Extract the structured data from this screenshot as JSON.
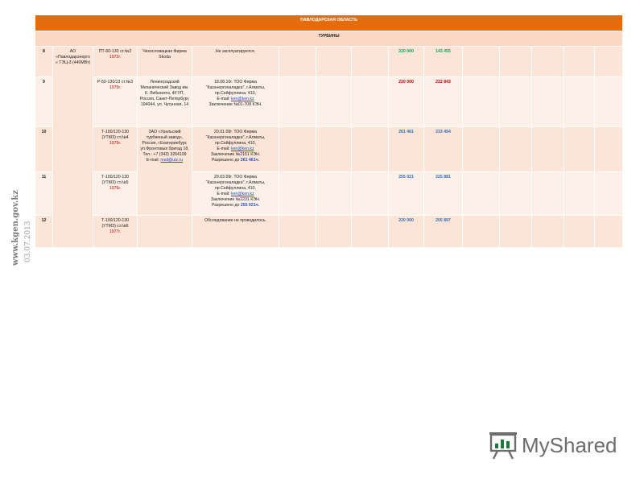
{
  "side": {
    "url": "www.kgen.gov.kz",
    "date": "03.07.2013"
  },
  "table": {
    "region": "ПАВЛОДАРСКАЯ ОБЛАСТЬ",
    "section": "ТУРБИНЫ",
    "owner": "АО «Павлодарэнерго» ТЭЦ-3 (440МВт)",
    "rows": [
      {
        "num": "8",
        "turbine": "ПТ-60-130 ст.№2",
        "year": "1972г.",
        "maker": "Чехословацкая Фирма Skoda",
        "status_lines": [
          "Не эксплуатируется."
        ],
        "email": "",
        "after_email": [],
        "val1": "220 000",
        "val2": "143 455"
      },
      {
        "num": "9",
        "turbine": "Р-50-130/13 ст.№3",
        "year": "1975г.",
        "maker": "Ленинградский Механический Завод им. К. Либкнехта, ФГУП, Россия, Санкт-Петербург, 194044, ул. Чугунная, 14",
        "status_lines": [
          "18.08.10г. ТОО Фирма \"Казэнергоналадка\", г.Алматы, пр.Сейфуллина, 410,"
        ],
        "email_label": "E-mail:",
        "email": "ken@ken.kz",
        "after_email": [
          "Заключение №01-708 КЭН."
        ],
        "val1": "220 000",
        "val2": "222 843"
      },
      {
        "num": "10",
        "turbine": "Т-100/120-130 (УТМЗ) ст.№4",
        "year": "1975г.",
        "maker": "ЗАО «Уральский турбинный завод», Россия, г.Екатеринбург, ул.Фронтовых бригад 18, Тел.: +7 (343) 3264109",
        "maker_email_label": "E-mail:",
        "maker_email": "mail@utz.ru",
        "status_lines": [
          "20.01.09г. ТОО Фирма \"Казэнергоналадка\", г.Алматы, пр.Сейфуллина, 410,"
        ],
        "email_label": "E-mail:",
        "email": "ken@ken.kz",
        "after_email": [
          "Заключение №2151 КЭН."
        ],
        "allowed_label": "Разрешено до",
        "allowed_value": "261 461ч.",
        "val1": "261 461",
        "val2": "233 454"
      },
      {
        "num": "11",
        "turbine": "Т-100/120-130 (УТМЗ) ст.№5",
        "year": "1976г.",
        "status_lines": [
          "29.03.09г. ТОО Фирма \"Казэнергоналадка\", г.Алматы, пр.Сейфуллина, 410,"
        ],
        "email_label": "E-mail:",
        "email": "ken@ken.kz",
        "after_email": [
          "Заключение №2231 КЭН."
        ],
        "allowed_label": "Разрешено до",
        "allowed_value": "255 021ч.",
        "val1": "255 021",
        "val2": "225 881"
      },
      {
        "num": "12",
        "turbine": "Т-100/120-130 (УТМЗ) ст.№6",
        "year": "1977г.",
        "status_lines": [
          "Обследование не проводилось."
        ],
        "email": "",
        "after_email": [],
        "val1": "220 000",
        "val2": "205 897"
      }
    ]
  },
  "logo": {
    "text": "MyShared",
    "icon": "presentation-board-icon",
    "color": "#6d6d6d",
    "accent": "#1e7a3c"
  }
}
